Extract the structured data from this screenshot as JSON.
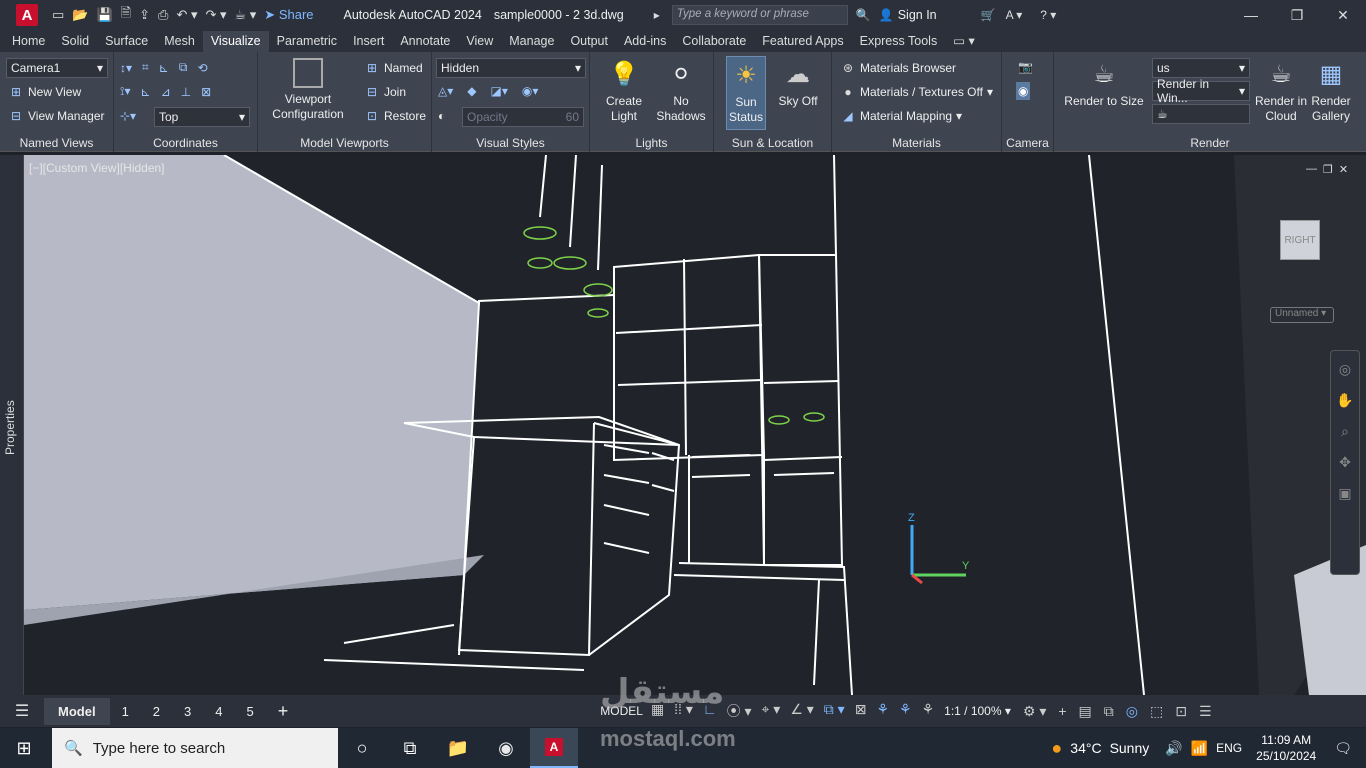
{
  "titlebar": {
    "app_letter": "A",
    "share": "Share",
    "app_title": "Autodesk AutoCAD 2024",
    "doc_title": "sample0000 - 2 3d.dwg",
    "search_placeholder": "Type a keyword or phrase",
    "sign_in": "Sign In"
  },
  "menu": [
    "Home",
    "Solid",
    "Surface",
    "Mesh",
    "Visualize",
    "Parametric",
    "Insert",
    "Annotate",
    "View",
    "Manage",
    "Output",
    "Add-ins",
    "Collaborate",
    "Featured Apps",
    "Express Tools"
  ],
  "ribbon": {
    "named_views": {
      "camera": "Camera1",
      "new_view": "New View",
      "view_manager": "View Manager",
      "title": "Named Views"
    },
    "coordinates": {
      "ucs": "Top",
      "title": "Coordinates"
    },
    "viewports": {
      "config": "Viewport Configuration",
      "named": "Named",
      "join": "Join",
      "restore": "Restore",
      "title": "Model Viewports"
    },
    "visual_styles": {
      "style": "Hidden",
      "opacity_label": "Opacity",
      "opacity_value": "60",
      "title": "Visual Styles"
    },
    "lights": {
      "create": "Create Light",
      "shadows": "No Shadows",
      "title": "Lights"
    },
    "sun": {
      "status": "Sun Status",
      "sky": "Sky Off",
      "title": "Sun & Location"
    },
    "materials": {
      "browser": "Materials Browser",
      "textures": "Materials / Textures Off",
      "mapping": "Material Mapping",
      "title": "Materials"
    },
    "camera": {
      "title": "Camera"
    },
    "render": {
      "to_size": "Render to Size",
      "preset": "us",
      "window": "Render in Win...",
      "cloud": "Render in Cloud",
      "gallery": "Render Gallery",
      "title": "Render"
    }
  },
  "viewport": {
    "label": "[−][Custom View][Hidden]",
    "cube": "RIGHT",
    "ucs_name": "Unnamed",
    "sidebar": "Properties"
  },
  "status": {
    "tabs": [
      "Model",
      "1",
      "2",
      "3",
      "4",
      "5"
    ],
    "model": "MODEL",
    "scale": "1:1 / 100%"
  },
  "taskbar": {
    "search": "Type here to search",
    "temp": "34°C",
    "weather": "Sunny",
    "lang": "ENG",
    "time": "11:09 AM",
    "date": "25/10/2024"
  },
  "watermark": {
    "brand": "مستقل",
    "domain": "mostaql.com"
  }
}
